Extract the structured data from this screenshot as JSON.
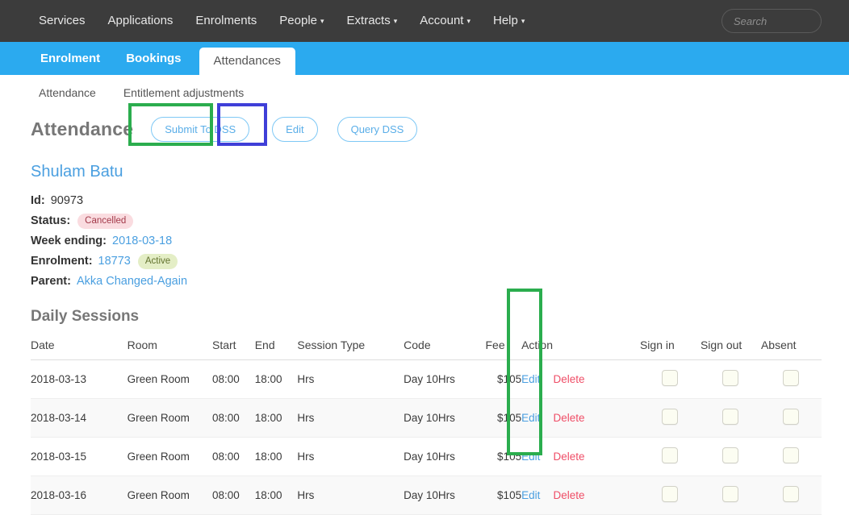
{
  "topnav": {
    "items": [
      {
        "label": "Services",
        "caret": false
      },
      {
        "label": "Applications",
        "caret": false
      },
      {
        "label": "Enrolments",
        "caret": false
      },
      {
        "label": "People",
        "caret": true
      },
      {
        "label": "Extracts",
        "caret": true
      },
      {
        "label": "Account",
        "caret": true
      },
      {
        "label": "Help",
        "caret": true
      }
    ],
    "caret_glyph": "▾",
    "search": {
      "placeholder": "Search",
      "value": "",
      "icon": "search-icon"
    }
  },
  "tabs": {
    "items": [
      {
        "label": "Enrolment",
        "active": false
      },
      {
        "label": "Bookings",
        "active": false
      },
      {
        "label": "Attendances",
        "active": true
      }
    ]
  },
  "subnav": {
    "items": [
      {
        "label": "Attendance"
      },
      {
        "label": "Entitlement adjustments"
      }
    ]
  },
  "header": {
    "title": "Attendance",
    "buttons": [
      {
        "label": "Submit To DSS"
      },
      {
        "label": "Edit"
      },
      {
        "label": "Query DSS"
      }
    ]
  },
  "record": {
    "person_name": "Shulam Batu",
    "fields": [
      {
        "label": "Id:",
        "value": "90973",
        "type": "text"
      },
      {
        "label": "Status:",
        "value": "Cancelled",
        "type": "badge-cancelled"
      },
      {
        "label": "Week ending:",
        "value": "2018-03-18",
        "type": "link"
      },
      {
        "label": "Enrolment:",
        "value": "18773",
        "badge": "Active",
        "type": "link-badge"
      },
      {
        "label": "Parent:",
        "value": "Akka Changed-Again",
        "type": "link"
      }
    ]
  },
  "sessions": {
    "section_title": "Daily Sessions",
    "columns": [
      "Date",
      "Room",
      "Start",
      "End",
      "Session Type",
      "Code",
      "Fee",
      "Action",
      "",
      "Sign in",
      "Sign out",
      "Absent"
    ],
    "action_labels": {
      "edit": "Edit",
      "delete": "Delete"
    },
    "rows": [
      {
        "date": "2018-03-13",
        "room": "Green Room",
        "start": "08:00",
        "end": "18:00",
        "type": "Hrs",
        "code": "Day 10Hrs",
        "fee": "$105",
        "sign_in": false,
        "sign_out": false,
        "absent": false
      },
      {
        "date": "2018-03-14",
        "room": "Green Room",
        "start": "08:00",
        "end": "18:00",
        "type": "Hrs",
        "code": "Day 10Hrs",
        "fee": "$105",
        "sign_in": false,
        "sign_out": false,
        "absent": false
      },
      {
        "date": "2018-03-15",
        "room": "Green Room",
        "start": "08:00",
        "end": "18:00",
        "type": "Hrs",
        "code": "Day 10Hrs",
        "fee": "$105",
        "sign_in": false,
        "sign_out": false,
        "absent": false
      },
      {
        "date": "2018-03-16",
        "room": "Green Room",
        "start": "08:00",
        "end": "18:00",
        "type": "Hrs",
        "code": "Day 10Hrs",
        "fee": "$105",
        "sign_in": false,
        "sign_out": false,
        "absent": false
      }
    ]
  },
  "annotations": [
    {
      "name": "submit-to-dss-highlight",
      "color": "#2bad4e"
    },
    {
      "name": "edit-highlight",
      "color": "#3f3fd8"
    },
    {
      "name": "action-column-highlight",
      "color": "#2bad4e"
    }
  ],
  "colors": {
    "topbar": "#3c3c3c",
    "tabbar": "#2baaef",
    "link": "#4a9fe0",
    "delete": "#ef4e67",
    "anno_green": "#2bad4e",
    "anno_blue": "#3f3fd8"
  }
}
